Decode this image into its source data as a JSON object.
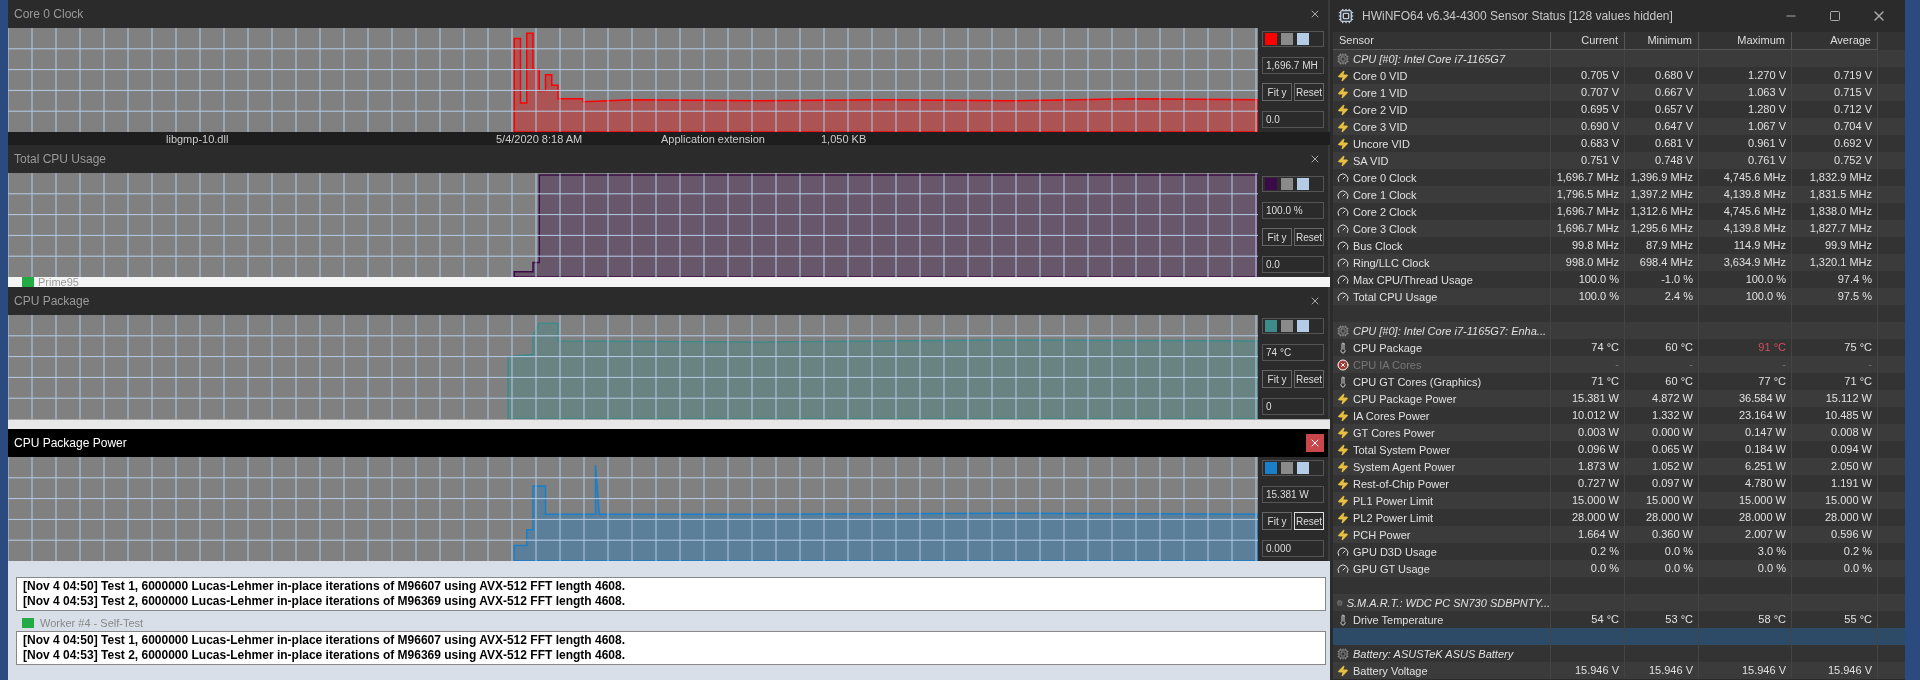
{
  "graph_windows": [
    {
      "title": "Core 0 Clock",
      "active": false,
      "color": "#ff0000",
      "current": "1,696.7 MH",
      "minimum": "0.0",
      "buttons": [
        {
          "label": "Fit y",
          "focused": false
        },
        {
          "label": "Reset",
          "focused": false
        }
      ]
    },
    {
      "title": "Total CPU Usage",
      "active": false,
      "color": "#3c0a46",
      "current": "100.0 %",
      "minimum": "0.0",
      "buttons": [
        {
          "label": "Fit y",
          "focused": false
        },
        {
          "label": "Reset",
          "focused": false
        }
      ]
    },
    {
      "title": "CPU Package",
      "active": false,
      "color": "#3f8a8a",
      "current": "74 °C",
      "minimum": "0",
      "buttons": [
        {
          "label": "Fit y",
          "focused": false
        },
        {
          "label": "Reset",
          "focused": false
        }
      ]
    },
    {
      "title": "CPU Package Power",
      "active": true,
      "color": "#1a7ec8",
      "current": "15.381 W",
      "minimum": "0.000",
      "buttons": [
        {
          "label": "Fit y",
          "focused": false
        },
        {
          "label": "Reset",
          "focused": true
        }
      ]
    }
  ],
  "background_file_row": {
    "name": "libgmp-10.dll",
    "date": "5/4/2020 8:18 AM",
    "type": "Application extension",
    "size": "1,050 KB"
  },
  "prime95": {
    "title": "Prime95",
    "workers": [
      {
        "lines": [
          "[Nov 4 04:50] Test 1, 6000000 Lucas-Lehmer in-place iterations of M96607 using AVX-512 FFT length 4608.",
          "[Nov 4 04:53] Test 2, 6000000 Lucas-Lehmer in-place iterations of M96369 using AVX-512 FFT length 4608."
        ]
      },
      {
        "title": "Worker #4 - Self-Test",
        "lines": [
          "[Nov 4 04:50] Test 1, 6000000 Lucas-Lehmer in-place iterations of M96607 using AVX-512 FFT length 4608.",
          "[Nov 4 04:53] Test 2, 6000000 Lucas-Lehmer in-place iterations of M96369 using AVX-512 FFT length 4608."
        ]
      }
    ]
  },
  "hwinfo": {
    "title": "HWiNFO64 v6.34-4300 Sensor Status [128 values hidden]",
    "columns": [
      "Sensor",
      "Current",
      "Minimum",
      "Maximum",
      "Average"
    ],
    "rows": [
      {
        "kind": "group",
        "label": "CPU [#0]: Intel Core i7-1165G7"
      },
      {
        "kind": "voltage",
        "label": "Core 0 VID",
        "values": [
          "0.705 V",
          "0.680 V",
          "1.270 V",
          "0.719 V"
        ],
        "disabled": false,
        "warning": false
      },
      {
        "kind": "voltage",
        "label": "Core 1 VID",
        "values": [
          "0.707 V",
          "0.667 V",
          "1.063 V",
          "0.715 V"
        ],
        "disabled": false,
        "warning": false
      },
      {
        "kind": "voltage",
        "label": "Core 2 VID",
        "values": [
          "0.695 V",
          "0.657 V",
          "1.280 V",
          "0.712 V"
        ],
        "disabled": false,
        "warning": false
      },
      {
        "kind": "voltage",
        "label": "Core 3 VID",
        "values": [
          "0.690 V",
          "0.647 V",
          "1.067 V",
          "0.704 V"
        ],
        "disabled": false,
        "warning": false
      },
      {
        "kind": "voltage",
        "label": "Uncore VID",
        "values": [
          "0.683 V",
          "0.681 V",
          "0.961 V",
          "0.692 V"
        ],
        "disabled": false,
        "warning": false
      },
      {
        "kind": "voltage",
        "label": "SA VID",
        "values": [
          "0.751 V",
          "0.748 V",
          "0.761 V",
          "0.752 V"
        ],
        "disabled": false,
        "warning": false
      },
      {
        "kind": "clock",
        "label": "Core 0 Clock",
        "values": [
          "1,696.7 MHz",
          "1,396.9 MHz",
          "4,745.6 MHz",
          "1,832.9 MHz"
        ],
        "disabled": false,
        "warning": false
      },
      {
        "kind": "clock",
        "label": "Core 1 Clock",
        "values": [
          "1,796.5 MHz",
          "1,397.2 MHz",
          "4,139.8 MHz",
          "1,831.5 MHz"
        ],
        "disabled": false,
        "warning": false
      },
      {
        "kind": "clock",
        "label": "Core 2 Clock",
        "values": [
          "1,696.7 MHz",
          "1,312.6 MHz",
          "4,745.6 MHz",
          "1,838.0 MHz"
        ],
        "disabled": false,
        "warning": false
      },
      {
        "kind": "clock",
        "label": "Core 3 Clock",
        "values": [
          "1,696.7 MHz",
          "1,295.6 MHz",
          "4,139.8 MHz",
          "1,827.7 MHz"
        ],
        "disabled": false,
        "warning": false
      },
      {
        "kind": "clock",
        "label": "Bus Clock",
        "values": [
          "99.8 MHz",
          "87.9 MHz",
          "114.9 MHz",
          "99.9 MHz"
        ],
        "disabled": false,
        "warning": false
      },
      {
        "kind": "clock",
        "label": "Ring/LLC Clock",
        "values": [
          "998.0 MHz",
          "698.4 MHz",
          "3,634.9 MHz",
          "1,320.1 MHz"
        ],
        "disabled": false,
        "warning": false
      },
      {
        "kind": "usage",
        "label": "Max CPU/Thread Usage",
        "values": [
          "100.0 %",
          "-1.0 %",
          "100.0 %",
          "97.4 %"
        ],
        "disabled": false,
        "warning": false
      },
      {
        "kind": "usage",
        "label": "Total CPU Usage",
        "values": [
          "100.0 %",
          "2.4 %",
          "100.0 %",
          "97.5 %"
        ],
        "disabled": false,
        "warning": false
      },
      {
        "kind": "spacer",
        "selected": false
      },
      {
        "kind": "group",
        "label": "CPU [#0]: Intel Core i7-1165G7: Enha..."
      },
      {
        "kind": "temperature",
        "label": "CPU Package",
        "values": [
          "74 °C",
          "60 °C",
          "91 °C",
          "75 °C"
        ],
        "disabled": false,
        "warning": true
      },
      {
        "kind": "error",
        "label": "CPU IA Cores",
        "values": [
          "-",
          "-",
          "-",
          "-"
        ],
        "disabled": true,
        "warning": false
      },
      {
        "kind": "temperature",
        "label": "CPU GT Cores (Graphics)",
        "values": [
          "71 °C",
          "60 °C",
          "77 °C",
          "71 °C"
        ],
        "disabled": false,
        "warning": false
      },
      {
        "kind": "power",
        "label": "CPU Package Power",
        "values": [
          "15.381 W",
          "4.872 W",
          "36.584 W",
          "15.112 W"
        ],
        "disabled": false,
        "warning": false
      },
      {
        "kind": "power",
        "label": "IA Cores Power",
        "values": [
          "10.012 W",
          "1.332 W",
          "23.164 W",
          "10.485 W"
        ],
        "disabled": false,
        "warning": false
      },
      {
        "kind": "power",
        "label": "GT Cores Power",
        "values": [
          "0.003 W",
          "0.000 W",
          "0.147 W",
          "0.008 W"
        ],
        "disabled": false,
        "warning": false
      },
      {
        "kind": "power",
        "label": "Total System Power",
        "values": [
          "0.096 W",
          "0.065 W",
          "0.184 W",
          "0.094 W"
        ],
        "disabled": false,
        "warning": false
      },
      {
        "kind": "power",
        "label": "System Agent Power",
        "values": [
          "1.873 W",
          "1.052 W",
          "6.251 W",
          "2.050 W"
        ],
        "disabled": false,
        "warning": false
      },
      {
        "kind": "power",
        "label": "Rest-of-Chip Power",
        "values": [
          "0.727 W",
          "0.097 W",
          "4.780 W",
          "1.191 W"
        ],
        "disabled": false,
        "warning": false
      },
      {
        "kind": "power",
        "label": "PL1 Power Limit",
        "values": [
          "15.000 W",
          "15.000 W",
          "15.000 W",
          "15.000 W"
        ],
        "disabled": false,
        "warning": false
      },
      {
        "kind": "power",
        "label": "PL2 Power Limit",
        "values": [
          "28.000 W",
          "28.000 W",
          "28.000 W",
          "28.000 W"
        ],
        "disabled": false,
        "warning": false
      },
      {
        "kind": "power",
        "label": "PCH Power",
        "values": [
          "1.664 W",
          "0.360 W",
          "2.007 W",
          "0.596 W"
        ],
        "disabled": false,
        "warning": false
      },
      {
        "kind": "usage",
        "label": "GPU D3D Usage",
        "values": [
          "0.2 %",
          "0.0 %",
          "3.0 %",
          "0.2 %"
        ],
        "disabled": false,
        "warning": false
      },
      {
        "kind": "usage",
        "label": "GPU GT Usage",
        "values": [
          "0.0 %",
          "0.0 %",
          "0.0 %",
          "0.0 %"
        ],
        "disabled": false,
        "warning": false
      },
      {
        "kind": "spacer",
        "selected": false
      },
      {
        "kind": "group",
        "label": "S.M.A.R.T.: WDC PC SN730 SDBPNTY..."
      },
      {
        "kind": "temperature",
        "label": "Drive Temperature",
        "values": [
          "54 °C",
          "53 °C",
          "58 °C",
          "55 °C"
        ],
        "disabled": false,
        "warning": false
      },
      {
        "kind": "spacer",
        "selected": true
      },
      {
        "kind": "group",
        "label": "Battery: ASUSTeK ASUS Battery"
      },
      {
        "kind": "voltage",
        "label": "Battery Voltage",
        "values": [
          "15.946 V",
          "15.946 V",
          "15.946 V",
          "15.946 V"
        ],
        "disabled": false,
        "warning": false
      }
    ]
  }
}
